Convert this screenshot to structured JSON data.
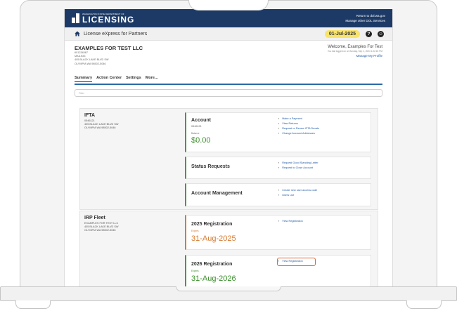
{
  "header": {
    "logo_small": "WASHINGTON STATE DEPARTMENT OF",
    "logo_big": "LICENSING",
    "link_return": "Return to dol.wa.gov",
    "link_manage": "Manage other DOL Services"
  },
  "nav": {
    "title": "License eXpress for Partners",
    "date": "01-Jul-2025",
    "help_glyph": "?",
    "profile_glyph": "☺"
  },
  "account": {
    "name": "EXAMPLES FOR TEST LLC",
    "lines": [
      "601234567",
      "MAILING",
      "405 BLACK LAKE BLVD SW",
      "OLYMPIA WA 98502-5046"
    ],
    "welcome": "Welcome, Examples For Test",
    "last_login": "You last logged on on Sunday, Sep 1, 2024 1:22:15 PM",
    "manage_profile": "Manage My Profile"
  },
  "tabs": [
    "Summary",
    "Action Center",
    "Settings",
    "More..."
  ],
  "filter_placeholder": "Filter",
  "ifta": {
    "title": "IFTA",
    "lines": [
      "0546121",
      "405 BLACK LAKE BLVD SW",
      "OLYMPIA WA 98502-5046"
    ],
    "account_card": {
      "title": "Account",
      "number": "0546121",
      "balance_label": "Balance",
      "balance": "$0.00",
      "links": [
        "Make a Payment",
        "View Returns",
        "Request or Renew IFTA Decals",
        "Change Account Addresses"
      ]
    },
    "status_card": {
      "title": "Status Requests",
      "links": [
        "Request Good Standing Letter",
        "Request to Close Account"
      ]
    },
    "mgmt_card": {
      "title": "Account Management",
      "links": [
        "Create new user access code",
        "Users List"
      ]
    }
  },
  "irp": {
    "title": "IRP Fleet",
    "lines": [
      "EXAMPLES FOR TEST LLC",
      "405 BLACK LAKE BLVD SW",
      "OLYMPIA WA 98502-5046"
    ],
    "reg2025": {
      "title": "2025 Registration",
      "expires_label": "Expires",
      "date": "31-Aug-2025",
      "link": "View Registration"
    },
    "reg2026": {
      "title": "2026 Registration",
      "expires_label": "Expires",
      "date": "31-Aug-2026",
      "link": "View Registration"
    }
  },
  "colors": {
    "header_bg": "#1d3a66",
    "date_pill": "#f8e46b",
    "green": "#3a8f2a",
    "orange": "#d87a2f",
    "link": "#1e5aa8",
    "highlight": "#e0622a"
  },
  "icons": {
    "home": "home-icon",
    "help": "help-icon",
    "profile": "profile-icon",
    "chevron": "chevron-right-icon"
  }
}
